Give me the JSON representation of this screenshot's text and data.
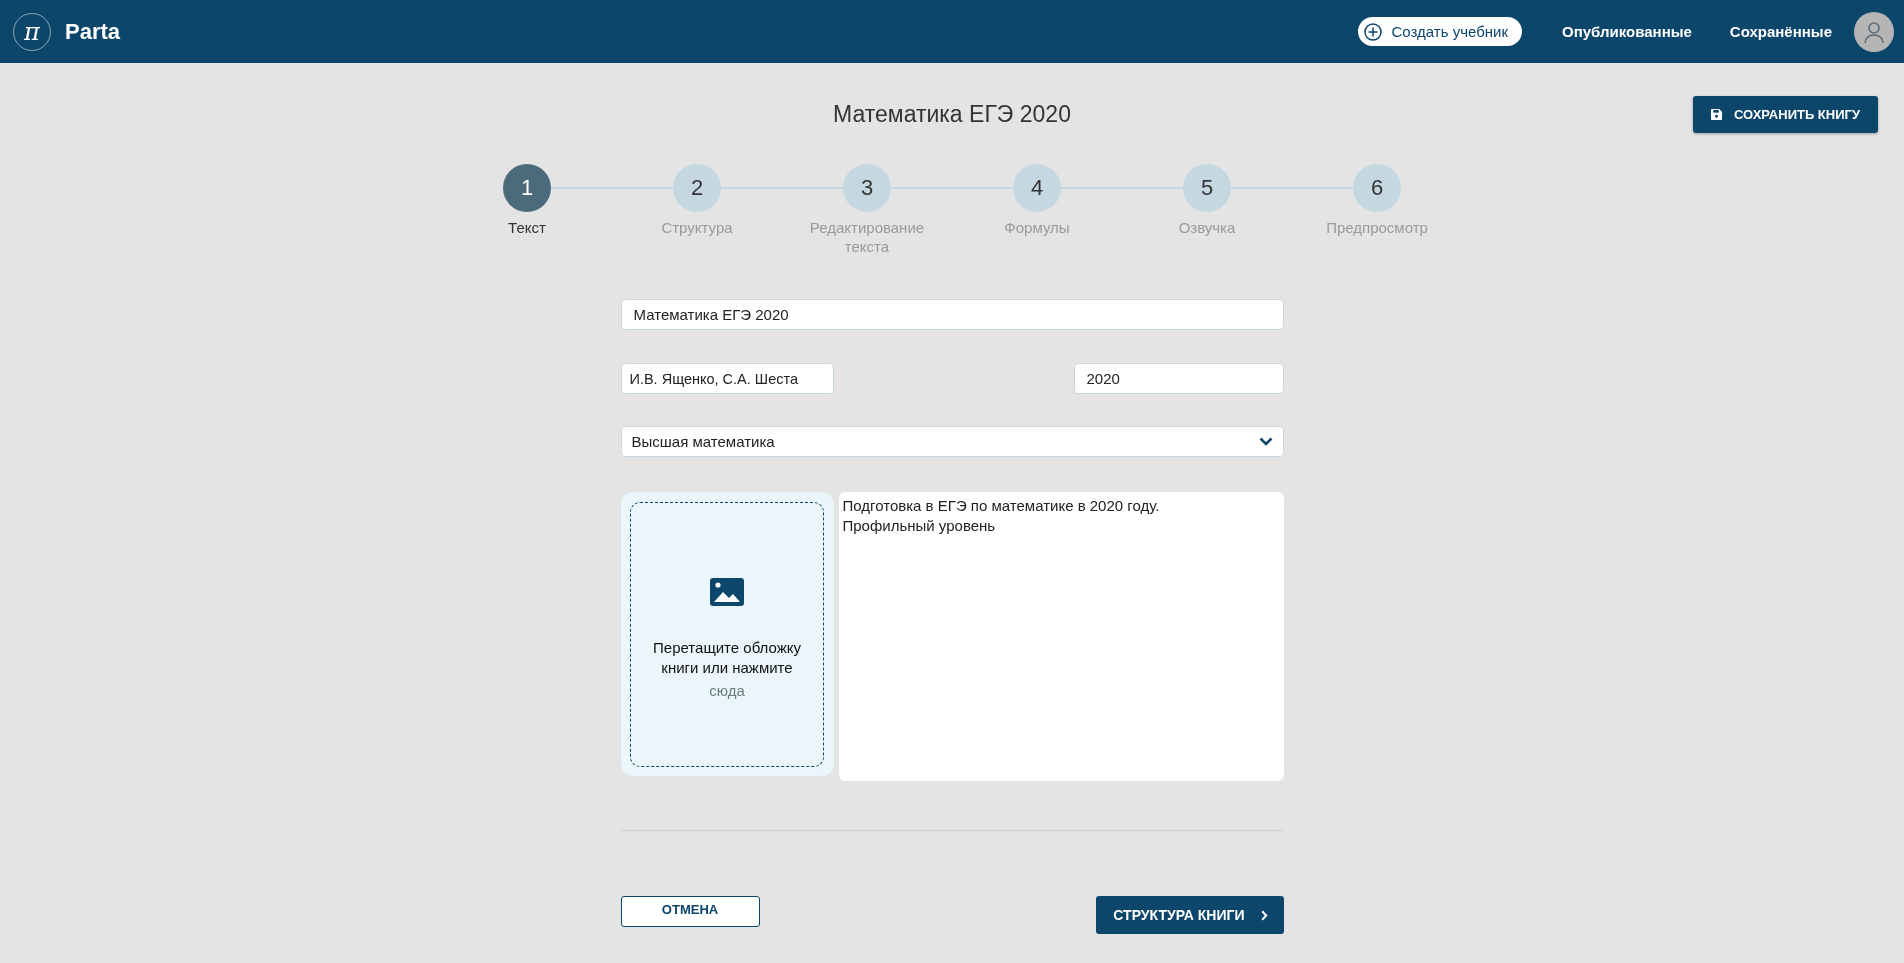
{
  "header": {
    "logo_symbol": "π",
    "brand": "Parta",
    "create_button": "Создать учебник",
    "nav": [
      {
        "label": "Опубликованные",
        "selected": false
      },
      {
        "label": "Сохранённые",
        "selected": false
      }
    ]
  },
  "page_title": "Математика ЕГЭ 2020",
  "save_button": "СОХРАНИТЬ КНИГУ",
  "steps": [
    {
      "number": "1",
      "label": "Текст",
      "selected": true
    },
    {
      "number": "2",
      "label": "Структура",
      "selected": false
    },
    {
      "number": "3",
      "label": "Редактирование текста",
      "selected": false
    },
    {
      "number": "4",
      "label": "Формулы",
      "selected": false
    },
    {
      "number": "5",
      "label": "Озвучка",
      "selected": false
    },
    {
      "number": "6",
      "label": "Предпросмотр",
      "selected": false
    }
  ],
  "form": {
    "title": "Математика ЕГЭ 2020",
    "authors": "И.В. Ященко, С.А. Шеста",
    "year": "2020",
    "subject": "Высшая математика",
    "cover_upload": {
      "text": "Перетащите обложку книги или нажмите",
      "link": "сюда"
    },
    "description": "Подготовка в ЕГЭ по математике в 2020 году.\nПрофильный уровень"
  },
  "buttons": {
    "cancel": "ОТМЕНА",
    "next": "СТРУКТУРА КНИГИ"
  }
}
